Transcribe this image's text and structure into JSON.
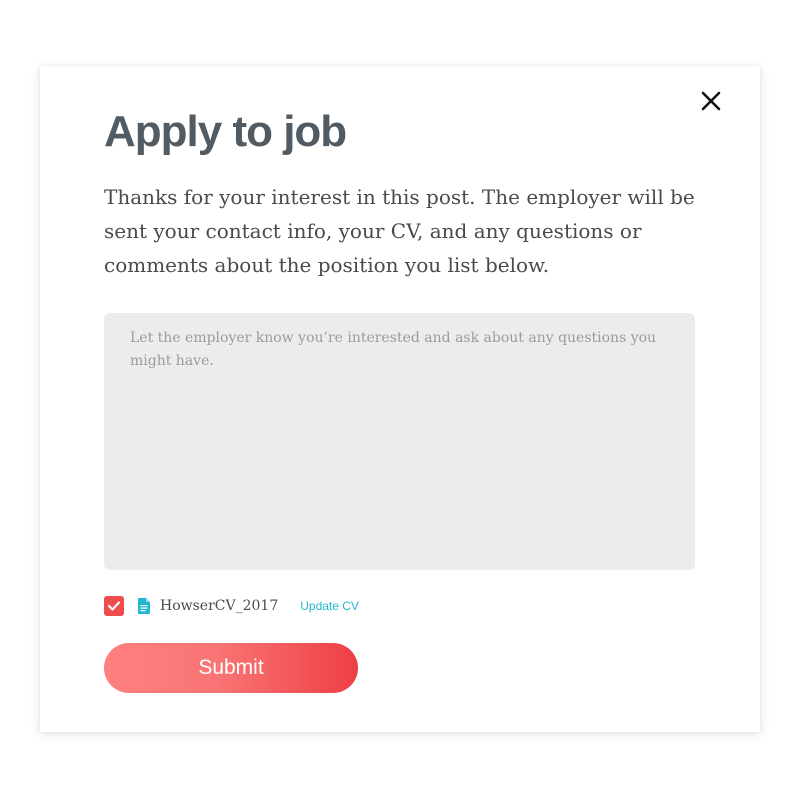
{
  "modal": {
    "title": "Apply to job",
    "intro": "Thanks for your interest in this post. The employer will be sent your contact info, your CV, and any questions or comments about the position you list below.",
    "message_placeholder": "Let the employer know you’re interested and ask about any questions you might have.",
    "message_value": "",
    "close_icon": "close-icon"
  },
  "cv": {
    "checked": true,
    "file_icon": "document-icon",
    "file_name": "HowserCV_2017",
    "update_label": "Update CV"
  },
  "actions": {
    "submit_label": "Submit"
  },
  "colors": {
    "title": "#515b63",
    "body_text": "#4a4a4a",
    "textarea_bg": "#ececec",
    "checkbox": "#ef4c4c",
    "link": "#22b8cf",
    "submit_gradient_start": "#ff8080",
    "submit_gradient_end": "#ec3f44"
  }
}
